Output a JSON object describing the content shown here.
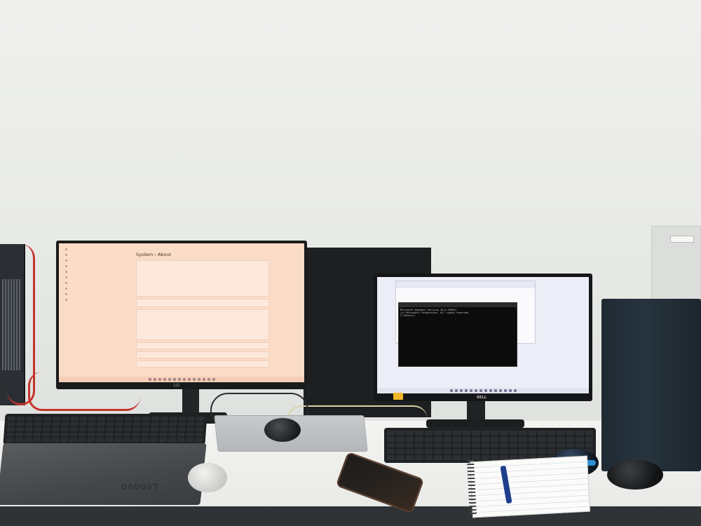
{
  "scene": {
    "left_monitor": {
      "settings_title": "System › About",
      "taskbar_icons": 14
    },
    "right_monitor": {
      "terminal_lines": [
        "Microsoft Windows [Version 10.0.19045]",
        "(c) Microsoft Corporation. All rights reserved.",
        "",
        "C:\\Users\\>"
      ]
    },
    "laptop_brand": "Lenovo",
    "left_monitor_brand": "LG",
    "right_monitor_brand": "DELL"
  }
}
